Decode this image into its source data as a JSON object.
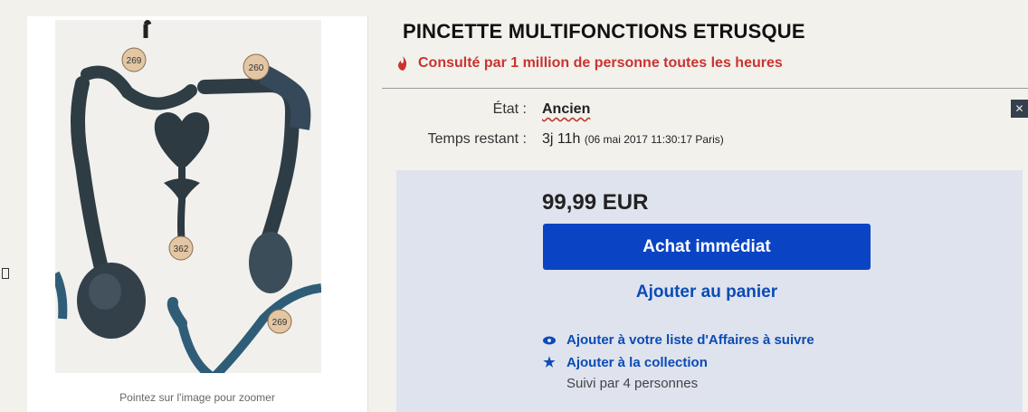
{
  "image_panel": {
    "zoom_hint": "Pointez sur l'image pour zoomer",
    "photo_tags": [
      "269",
      "260",
      "362",
      "269"
    ]
  },
  "listing": {
    "title": "PINCETTE MULTIFONCTIONS ETRUSQUE",
    "watchers_text": "Consulté par 1 million de personne toutes les heures",
    "condition_label": "État :",
    "condition_value": "Ancien",
    "time_label": "Temps restant :",
    "time_value": "3j 11h",
    "time_detail": "(06 mai 2017   11:30:17 Paris)"
  },
  "buy_box": {
    "price": "99,99 EUR",
    "buy_now_label": "Achat immédiat",
    "add_to_cart_label": "Ajouter au panier",
    "watch_label": "Ajouter à votre liste d'Affaires à suivre",
    "collection_label": "Ajouter à la collection",
    "followers_text": "Suivi par 4 personnes"
  },
  "icons": {
    "watchers": "flame-icon",
    "watch": "eye-icon",
    "collection": "star-icon",
    "close": "close-icon"
  },
  "colors": {
    "accent_blue": "#0a44c4",
    "link_blue": "#0b4bb5",
    "alert_red": "#c8342f",
    "buy_box_bg": "#dfe3ee"
  }
}
